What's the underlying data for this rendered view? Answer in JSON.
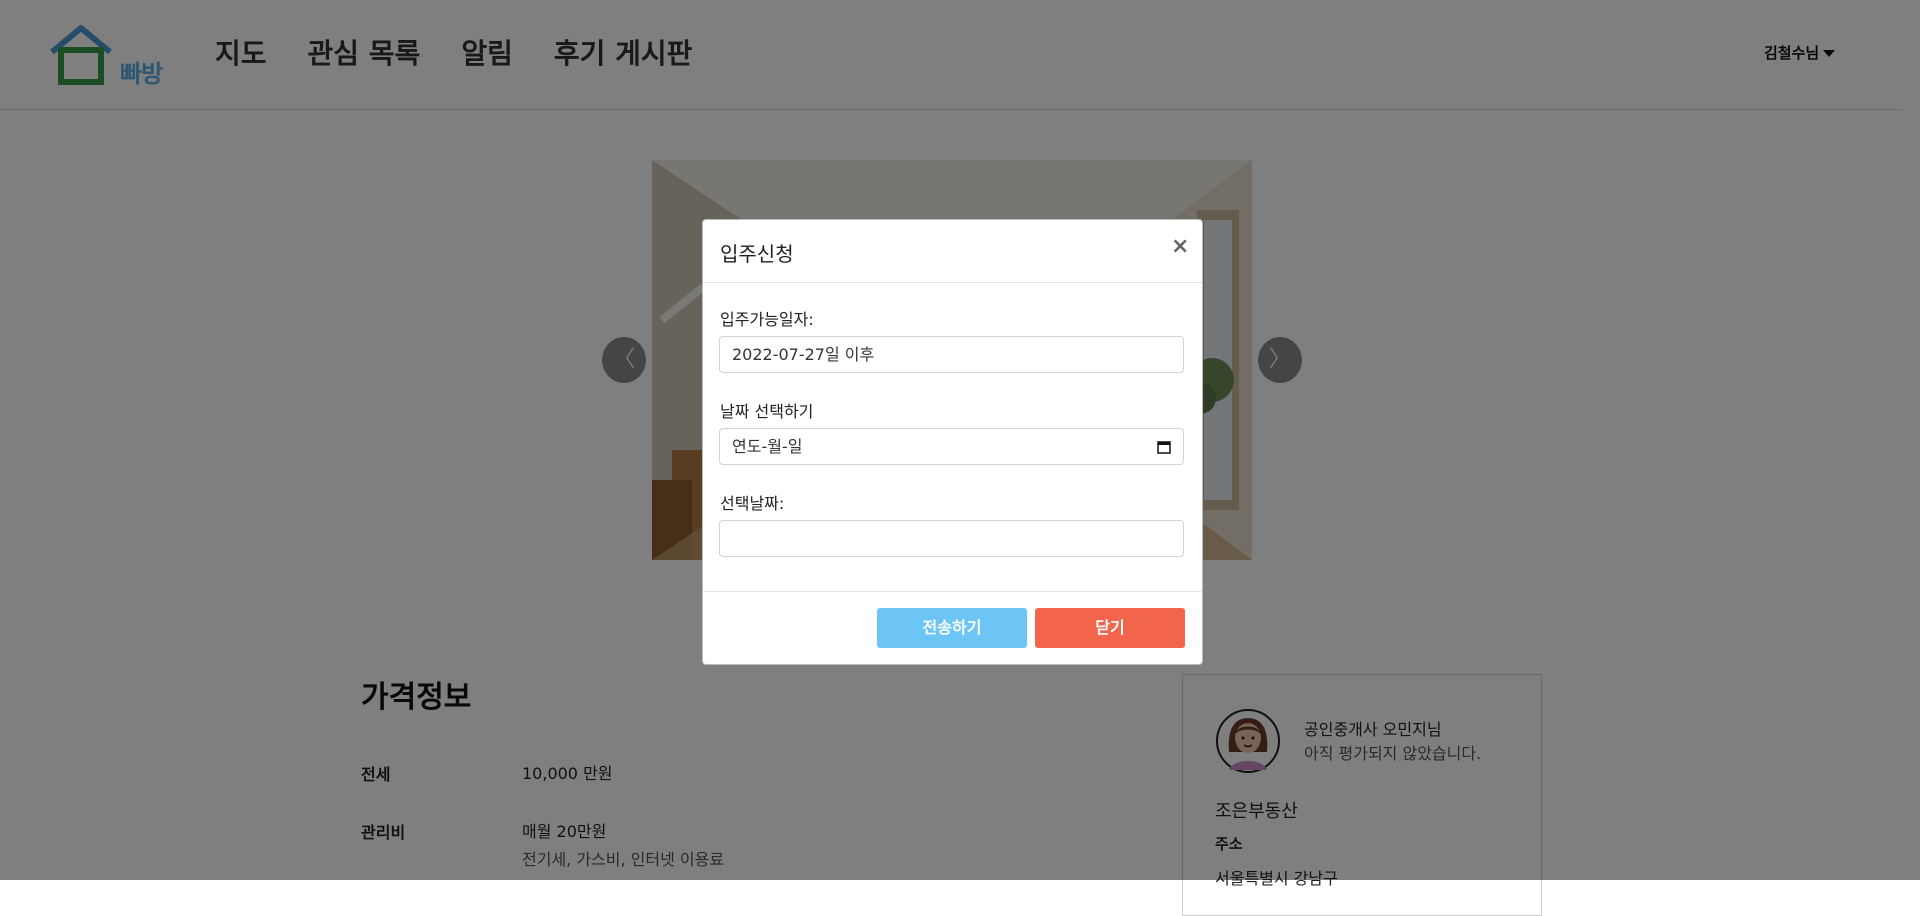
{
  "header": {
    "logo_text": "빠방",
    "nav": [
      "지도",
      "관심 목록",
      "알림",
      "후기 게시판"
    ],
    "user": "김철수님"
  },
  "carousel": {
    "prev": "〈",
    "next": "〉"
  },
  "price": {
    "title": "가격정보",
    "rows": [
      {
        "label": "전세",
        "value": "10,000 만원"
      },
      {
        "label": "관리비",
        "value": "매월 20만원",
        "sub": "전기세, 가스비, 인터넷 이용료"
      }
    ]
  },
  "agent": {
    "name": "공인중개사 오민지님",
    "rating": "아직 평가되지 않았습니다.",
    "agency": "조은부동산",
    "address_label": "주소",
    "address": "서울특별시 강남구"
  },
  "modal": {
    "title": "입주신청",
    "close_icon": "×",
    "available_label": "입주가능일자:",
    "available_value": "2022-07-27일 이후",
    "pick_label": "날짜 선택하기",
    "date_placeholder": "연도-월-일",
    "selected_label": "선택날짜:",
    "selected_value": "",
    "submit": "전송하기",
    "close": "닫기"
  },
  "colors": {
    "submit": "#6cc5f5",
    "close": "#f2654a",
    "logo": "#5aaee6",
    "logo_house": "#3a9a4a"
  }
}
